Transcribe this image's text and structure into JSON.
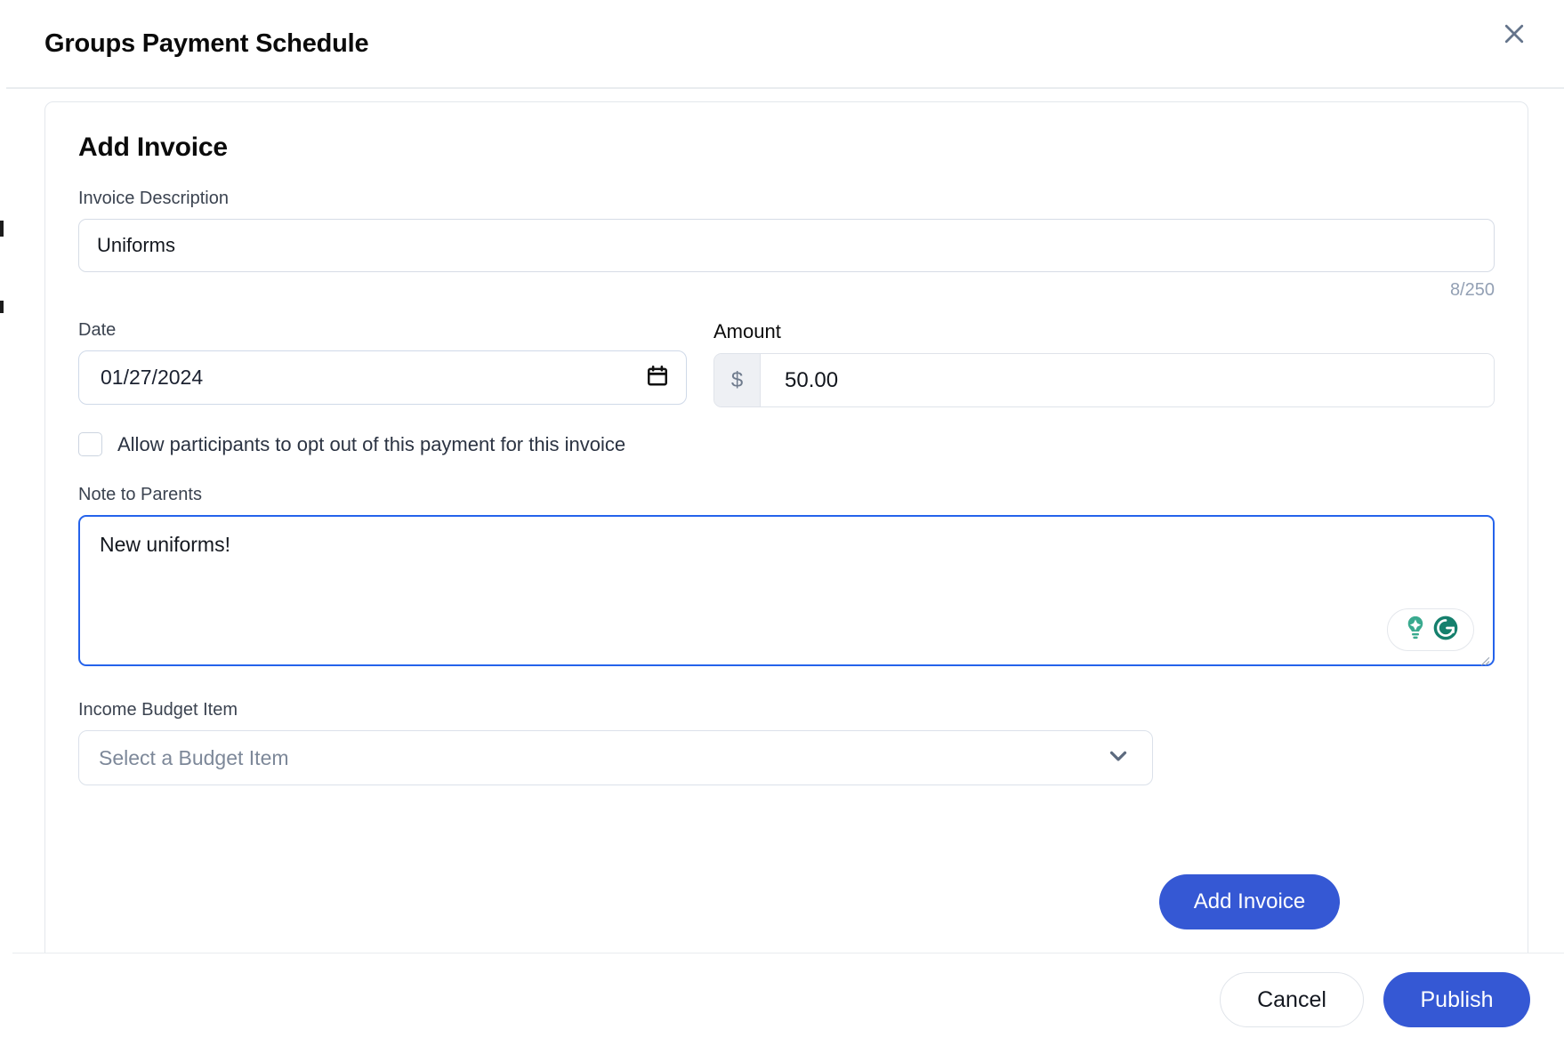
{
  "header": {
    "title": "Groups Payment Schedule",
    "close_icon": "close-icon"
  },
  "card": {
    "title": "Add Invoice",
    "description": {
      "label": "Invoice Description",
      "value": "Uniforms",
      "placeholder": "",
      "counter": "8/250"
    },
    "date": {
      "label": "Date",
      "value": "01/27/2024",
      "icon": "calendar-icon"
    },
    "amount": {
      "label": "Amount",
      "prefix": "$",
      "value": "50.00"
    },
    "opt_out": {
      "label": "Allow participants to opt out of this payment for this invoice",
      "checked": false
    },
    "note": {
      "label": "Note to Parents",
      "value": "New uniforms!",
      "placeholder": "",
      "assistant_badge": {
        "bulb_icon": "lightbulb-icon",
        "grammarly_icon": "grammarly-logo-icon"
      }
    },
    "budget_item": {
      "label": "Income Budget Item",
      "placeholder": "Select a Budget Item",
      "selected": "Select a Budget Item",
      "chevron_icon": "chevron-down-icon",
      "options": [
        "Select a Budget Item"
      ]
    },
    "add_invoice_button": "Add Invoice"
  },
  "footer": {
    "cancel_label": "Cancel",
    "publish_label": "Publish"
  },
  "colors": {
    "primary": "#3558d4",
    "focus_border": "#2563eb",
    "label_text": "#3b4350",
    "muted_text": "#93a0b4",
    "close_icon": "#64748b",
    "grammarly_green": "#15806d",
    "bulb_green": "#3aaa8f"
  }
}
